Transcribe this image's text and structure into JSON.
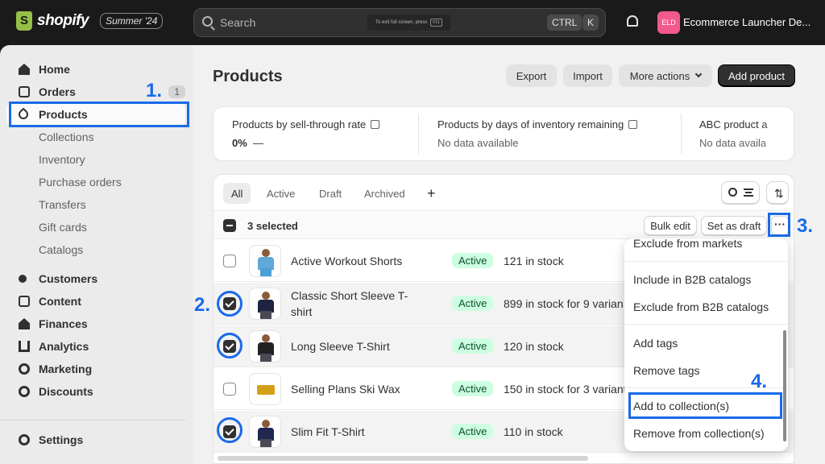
{
  "topbar": {
    "logo": "shopify",
    "edition": "Summer '24",
    "search_placeholder": "Search",
    "fullscreen_hint": "To exit full screen, press",
    "fullscreen_key": "F11",
    "shortcut_keys": [
      "CTRL",
      "K"
    ],
    "avatar_initials": "ELD",
    "store_name": "Ecommerce Launcher De..."
  },
  "sidebar": {
    "items": [
      {
        "label": "Home",
        "icon": "home-icon"
      },
      {
        "label": "Orders",
        "icon": "orders-icon",
        "badge": "1"
      },
      {
        "label": "Products",
        "icon": "tag-icon"
      },
      {
        "label": "Collections"
      },
      {
        "label": "Inventory"
      },
      {
        "label": "Purchase orders"
      },
      {
        "label": "Transfers"
      },
      {
        "label": "Gift cards"
      },
      {
        "label": "Catalogs"
      },
      {
        "label": "Customers",
        "icon": "person-icon"
      },
      {
        "label": "Content",
        "icon": "content-icon"
      },
      {
        "label": "Finances",
        "icon": "bank-icon"
      },
      {
        "label": "Analytics",
        "icon": "chart-icon"
      },
      {
        "label": "Marketing",
        "icon": "target-icon"
      },
      {
        "label": "Discounts",
        "icon": "discount-icon"
      }
    ],
    "settings_label": "Settings"
  },
  "annotations": [
    "1.",
    "2.",
    "3.",
    "4."
  ],
  "page": {
    "title": "Products",
    "export_label": "Export",
    "import_label": "Import",
    "more_actions_label": "More actions",
    "add_product_label": "Add product"
  },
  "metrics": [
    {
      "title": "Products by sell-through rate",
      "value": "0%",
      "suffix": "—"
    },
    {
      "title": "Products by days of inventory remaining",
      "value": "No data available"
    },
    {
      "title": "ABC product a",
      "value": "No data availa"
    }
  ],
  "tabs": [
    "All",
    "Active",
    "Draft",
    "Archived",
    "+"
  ],
  "bulk": {
    "selected_text": "3 selected",
    "bulk_edit_label": "Bulk edit",
    "set_draft_label": "Set as draft",
    "more_label": "···"
  },
  "products": [
    {
      "name": "Active Workout Shorts",
      "status": "Active",
      "inventory": "121 in stock",
      "checked": false
    },
    {
      "name": "Classic Short Sleeve T-shirt",
      "status": "Active",
      "inventory": "899 in stock for 9 varian",
      "checked": true
    },
    {
      "name": "Long Sleeve T-Shirt",
      "status": "Active",
      "inventory": "120 in stock",
      "checked": true
    },
    {
      "name": "Selling Plans Ski Wax",
      "status": "Active",
      "inventory": "150 in stock for 3 variant",
      "checked": false
    },
    {
      "name": "Slim Fit T-Shirt",
      "status": "Active",
      "inventory": "110 in stock",
      "checked": true
    }
  ],
  "menu": {
    "items": [
      "Exclude from markets",
      "Include in B2B catalogs",
      "Exclude from B2B catalogs",
      "Add tags",
      "Remove tags",
      "Add to collection(s)",
      "Remove from collection(s)"
    ]
  },
  "colors": {
    "annotation": "#1a6ae8",
    "status_bg": "#cdfee1",
    "status_fg": "#0c5132",
    "primary_button": "#303030"
  }
}
